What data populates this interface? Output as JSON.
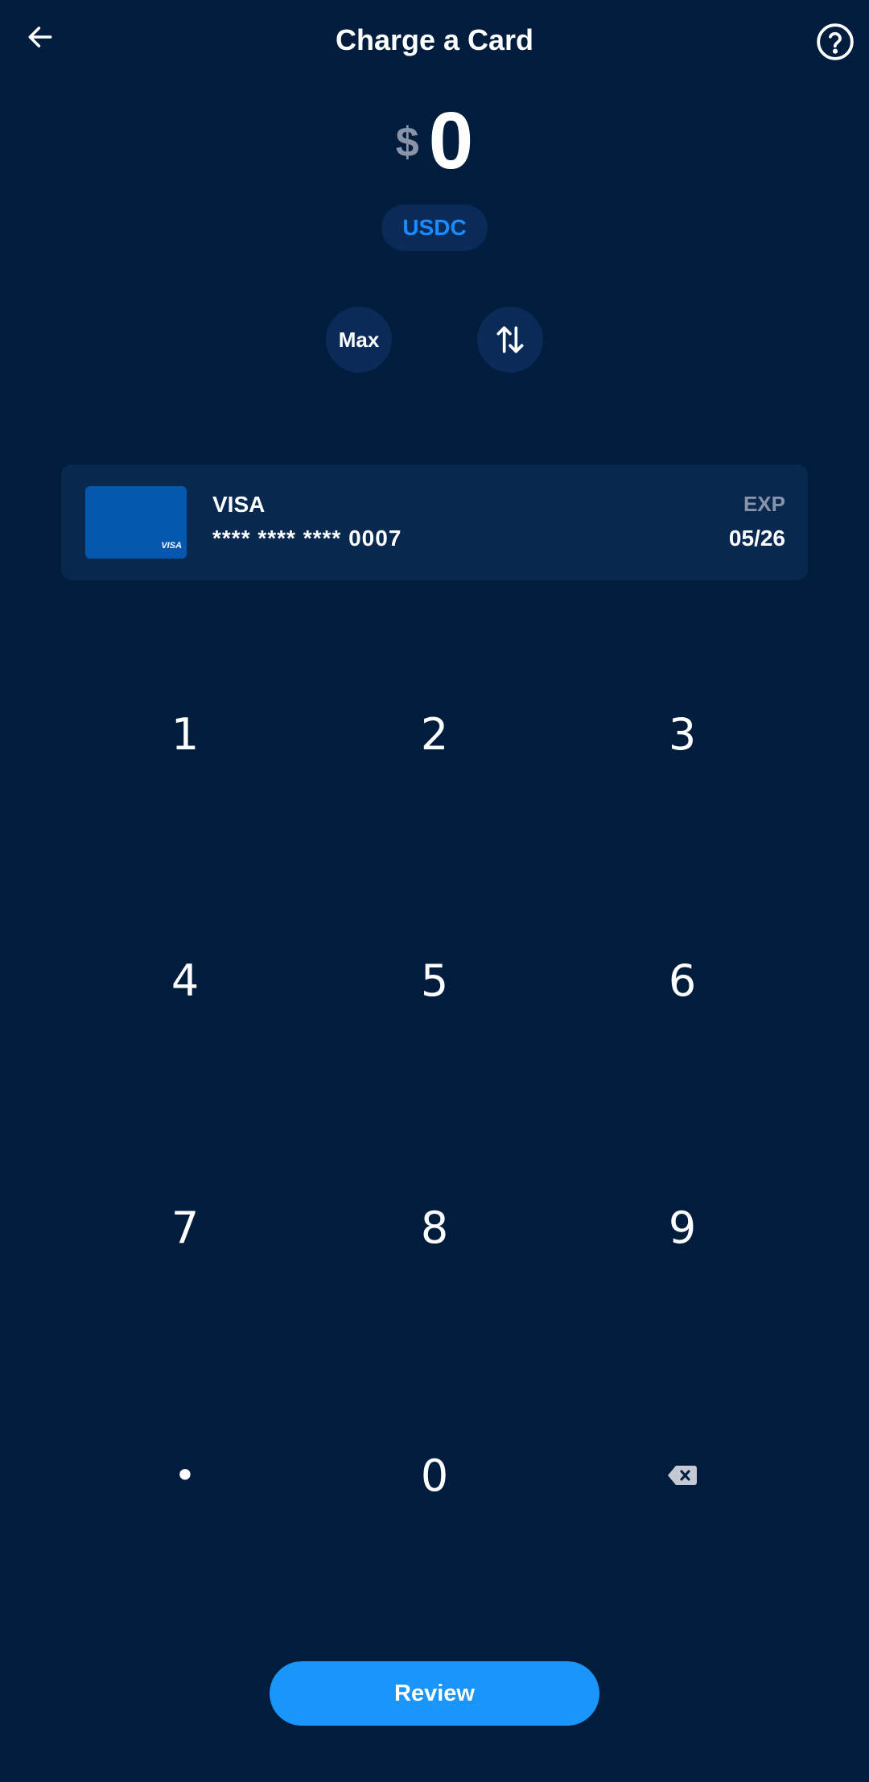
{
  "header": {
    "title": "Charge a Card",
    "back_icon": "arrow-left-icon",
    "help_icon": "question-circle-icon"
  },
  "amount": {
    "currency_symbol": "$",
    "value": "0",
    "unit": "USDC"
  },
  "actions": {
    "max_label": "Max",
    "swap_icon": "swap-arrows-icon"
  },
  "card": {
    "brand": "VISA",
    "thumb_logo": "VISA",
    "masked_number": "**** **** **** 0007",
    "exp_label": "EXP",
    "exp_value": "05/26"
  },
  "keypad": {
    "keys": [
      "1",
      "2",
      "3",
      "4",
      "5",
      "6",
      "7",
      "8",
      "9",
      "•",
      "0"
    ],
    "backspace_icon": "backspace-icon"
  },
  "review_label": "Review",
  "colors": {
    "background": "#011d3e",
    "accent": "#1a96fa",
    "pill": "#0a2a57",
    "card_surface": "#082850",
    "muted_text": "#8a94a8"
  }
}
